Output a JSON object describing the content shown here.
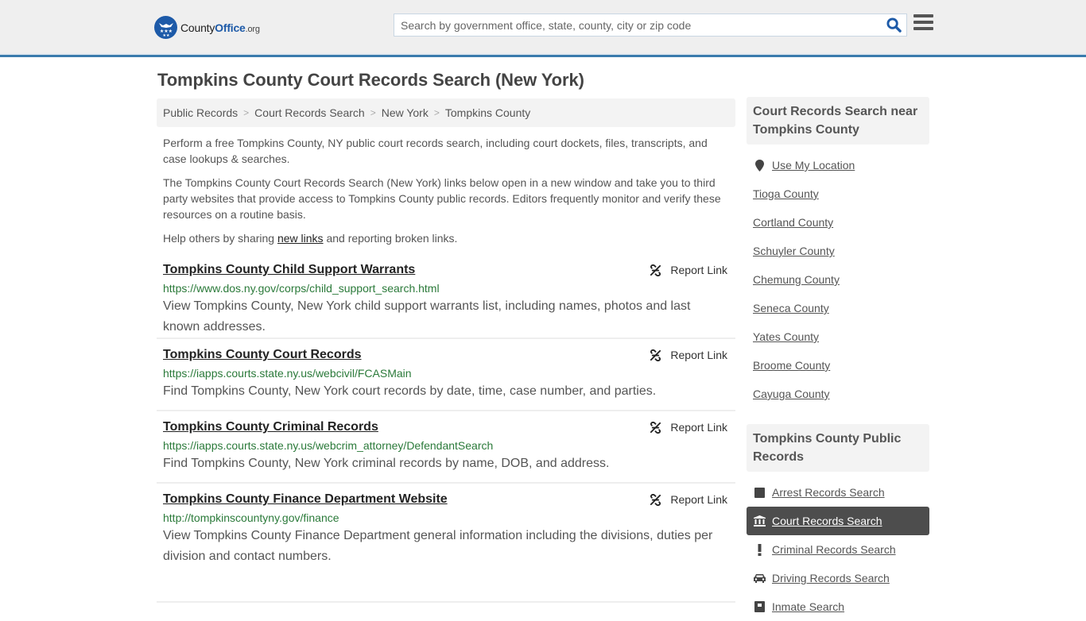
{
  "header": {
    "logo": {
      "brand_prefix": "County",
      "brand_main": "Office",
      "brand_suffix": ".org"
    },
    "search": {
      "placeholder": "Search by government office, state, county, city or zip code",
      "value": ""
    },
    "icons": {
      "search": "search-icon",
      "menu": "hamburger-menu-icon"
    }
  },
  "page": {
    "title": "Tompkins County Court Records Search (New York)",
    "breadcrumb": [
      "Public Records",
      "Court Records Search",
      "New York",
      "Tompkins County"
    ]
  },
  "intro": {
    "p1": "Perform a free Tompkins County, NY public court records search, including court dockets, files, transcripts, and case lookups & searches.",
    "p2": "The Tompkins County Court Records Search (New York) links below open in a new window and take you to third party websites that provide access to Tompkins County public records. Editors frequently monitor and verify these resources on a routine basis.",
    "p3_before": "Help others by sharing ",
    "p3_link": "new links",
    "p3_after": " and reporting broken links."
  },
  "entries": [
    {
      "title": "Tompkins County Child Support Warrants",
      "url": "https://www.dos.ny.gov/corps/child_support_search.html",
      "description": "View Tompkins County, New York child support warrants list, including names, photos and last known addresses.",
      "report_label": "Report Link"
    },
    {
      "title": "Tompkins County Court Records",
      "url": "https://iapps.courts.state.ny.us/webcivil/FCASMain",
      "description": "Find Tompkins County, New York court records by date, time, case number, and parties.",
      "report_label": "Report Link"
    },
    {
      "title": "Tompkins County Criminal Records",
      "url": "https://iapps.courts.state.ny.us/webcrim_attorney/DefendantSearch",
      "description": "Find Tompkins County, New York criminal records by name, DOB, and address.",
      "report_label": "Report Link"
    },
    {
      "title": "Tompkins County Finance Department Website",
      "url": "http://tompkinscountyny.gov/finance",
      "description": "View Tompkins County Finance Department general information including the divisions, duties per division and contact numbers.",
      "report_label": "Report Link"
    }
  ],
  "sidebar": {
    "nearby": {
      "heading": "Court Records Search near Tompkins County",
      "use_location": "Use My Location",
      "counties": [
        "Tioga County",
        "Cortland County",
        "Schuyler County",
        "Chemung County",
        "Seneca County",
        "Yates County",
        "Broome County",
        "Cayuga County"
      ]
    },
    "public_records": {
      "heading": "Tompkins County Public Records",
      "items": [
        {
          "label": "Arrest Records Search",
          "icon": "square-icon",
          "active": false
        },
        {
          "label": "Court Records Search",
          "icon": "courthouse-icon",
          "active": true
        },
        {
          "label": "Criminal Records Search",
          "icon": "exclamation-icon",
          "active": false
        },
        {
          "label": "Driving Records Search",
          "icon": "car-icon",
          "active": false
        },
        {
          "label": "Inmate Search",
          "icon": "inmate-icon",
          "active": false
        }
      ]
    }
  },
  "colors": {
    "brand_blue": "#1d5aa8",
    "header_border": "#3a7bad",
    "url_green": "#2b7a3a",
    "active_item_bg": "#4d4d4d"
  }
}
